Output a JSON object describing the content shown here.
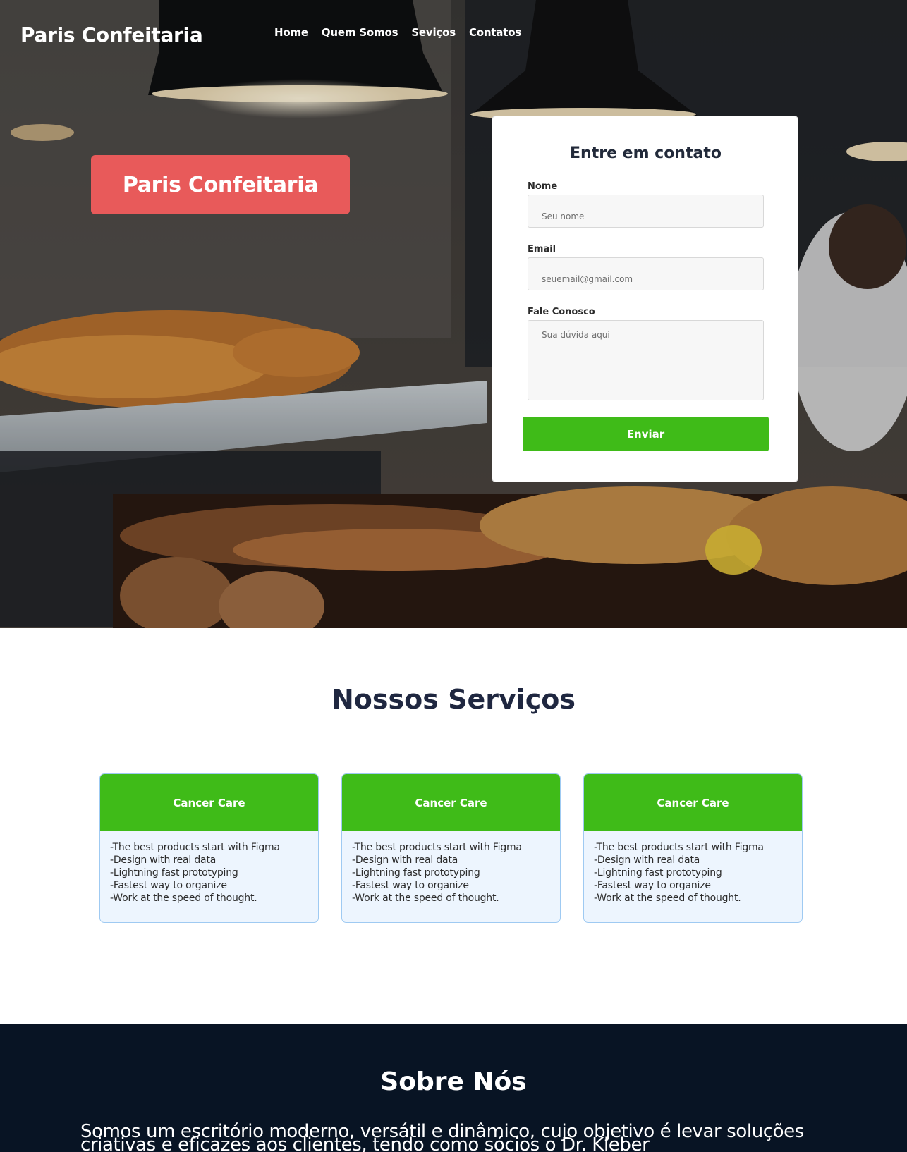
{
  "header": {
    "logo": "Paris Confeitaria",
    "nav": [
      {
        "label": "Home"
      },
      {
        "label": "Quem Somos"
      },
      {
        "label": "Seviços"
      },
      {
        "label": "Contatos"
      }
    ]
  },
  "hero": {
    "badge": "Paris Confeitaria"
  },
  "contact": {
    "title": "Entre em contato",
    "name_label": "Nome",
    "name_placeholder": "Seu nome",
    "email_label": "Email",
    "email_placeholder": "seuemail@gmail.com",
    "message_label": "Fale Conosco",
    "message_placeholder": "Sua dúvida aqui",
    "submit_label": "Enviar"
  },
  "services": {
    "title": "Nossos Serviços",
    "cards": [
      {
        "title": "Cancer Care",
        "lines": [
          "-The best products start with Figma",
          "-Design with real data",
          "-Lightning fast prototyping",
          "-Fastest way to organize",
          "-Work at the speed of thought."
        ]
      },
      {
        "title": "Cancer Care",
        "lines": [
          "-The best products start with Figma",
          "-Design with real data",
          "-Lightning fast prototyping",
          "-Fastest way to organize",
          "-Work at the speed of thought."
        ]
      },
      {
        "title": "Cancer Care",
        "lines": [
          "-The best products start with Figma",
          "-Design with real data",
          "-Lightning fast prototyping",
          "-Fastest way to organize",
          "-Work at the speed of thought."
        ]
      }
    ]
  },
  "about": {
    "title": "Sobre Nós",
    "text": "Somos um escritório moderno, versátil e dinâmico, cujo objetivo é levar soluções criativas e eficazes aos clientes, tendo como sócios o Dr. Kleber"
  },
  "colors": {
    "accent_green": "#3fbb18",
    "badge_red": "#e85a5a",
    "dark_navy": "#081424",
    "heading_navy": "#1f2740"
  }
}
